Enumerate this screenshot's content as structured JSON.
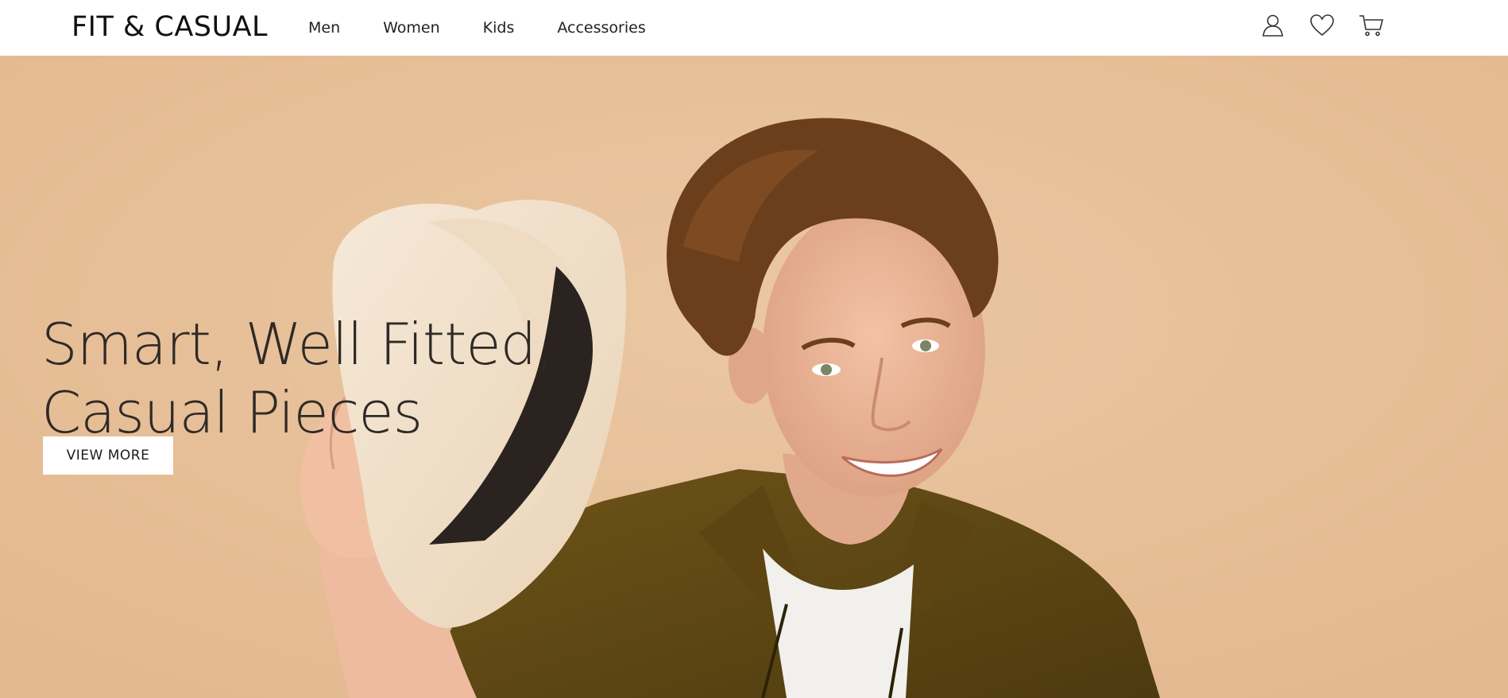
{
  "header": {
    "logo": "FIT & CASUAL",
    "nav": [
      {
        "label": "Men"
      },
      {
        "label": "Women"
      },
      {
        "label": "Kids"
      },
      {
        "label": "Accessories"
      }
    ],
    "icons": [
      "user-icon",
      "heart-icon",
      "cart-icon"
    ]
  },
  "hero": {
    "headline_line1": "Smart, Well Fitted,",
    "headline_line2": "Casual Pieces",
    "cta_label": "VIEW MORE",
    "background_color": "#e9c29b"
  },
  "colors": {
    "header_bg": "#ffffff",
    "text_dark": "#2f2a26",
    "button_bg": "#ffffff"
  }
}
